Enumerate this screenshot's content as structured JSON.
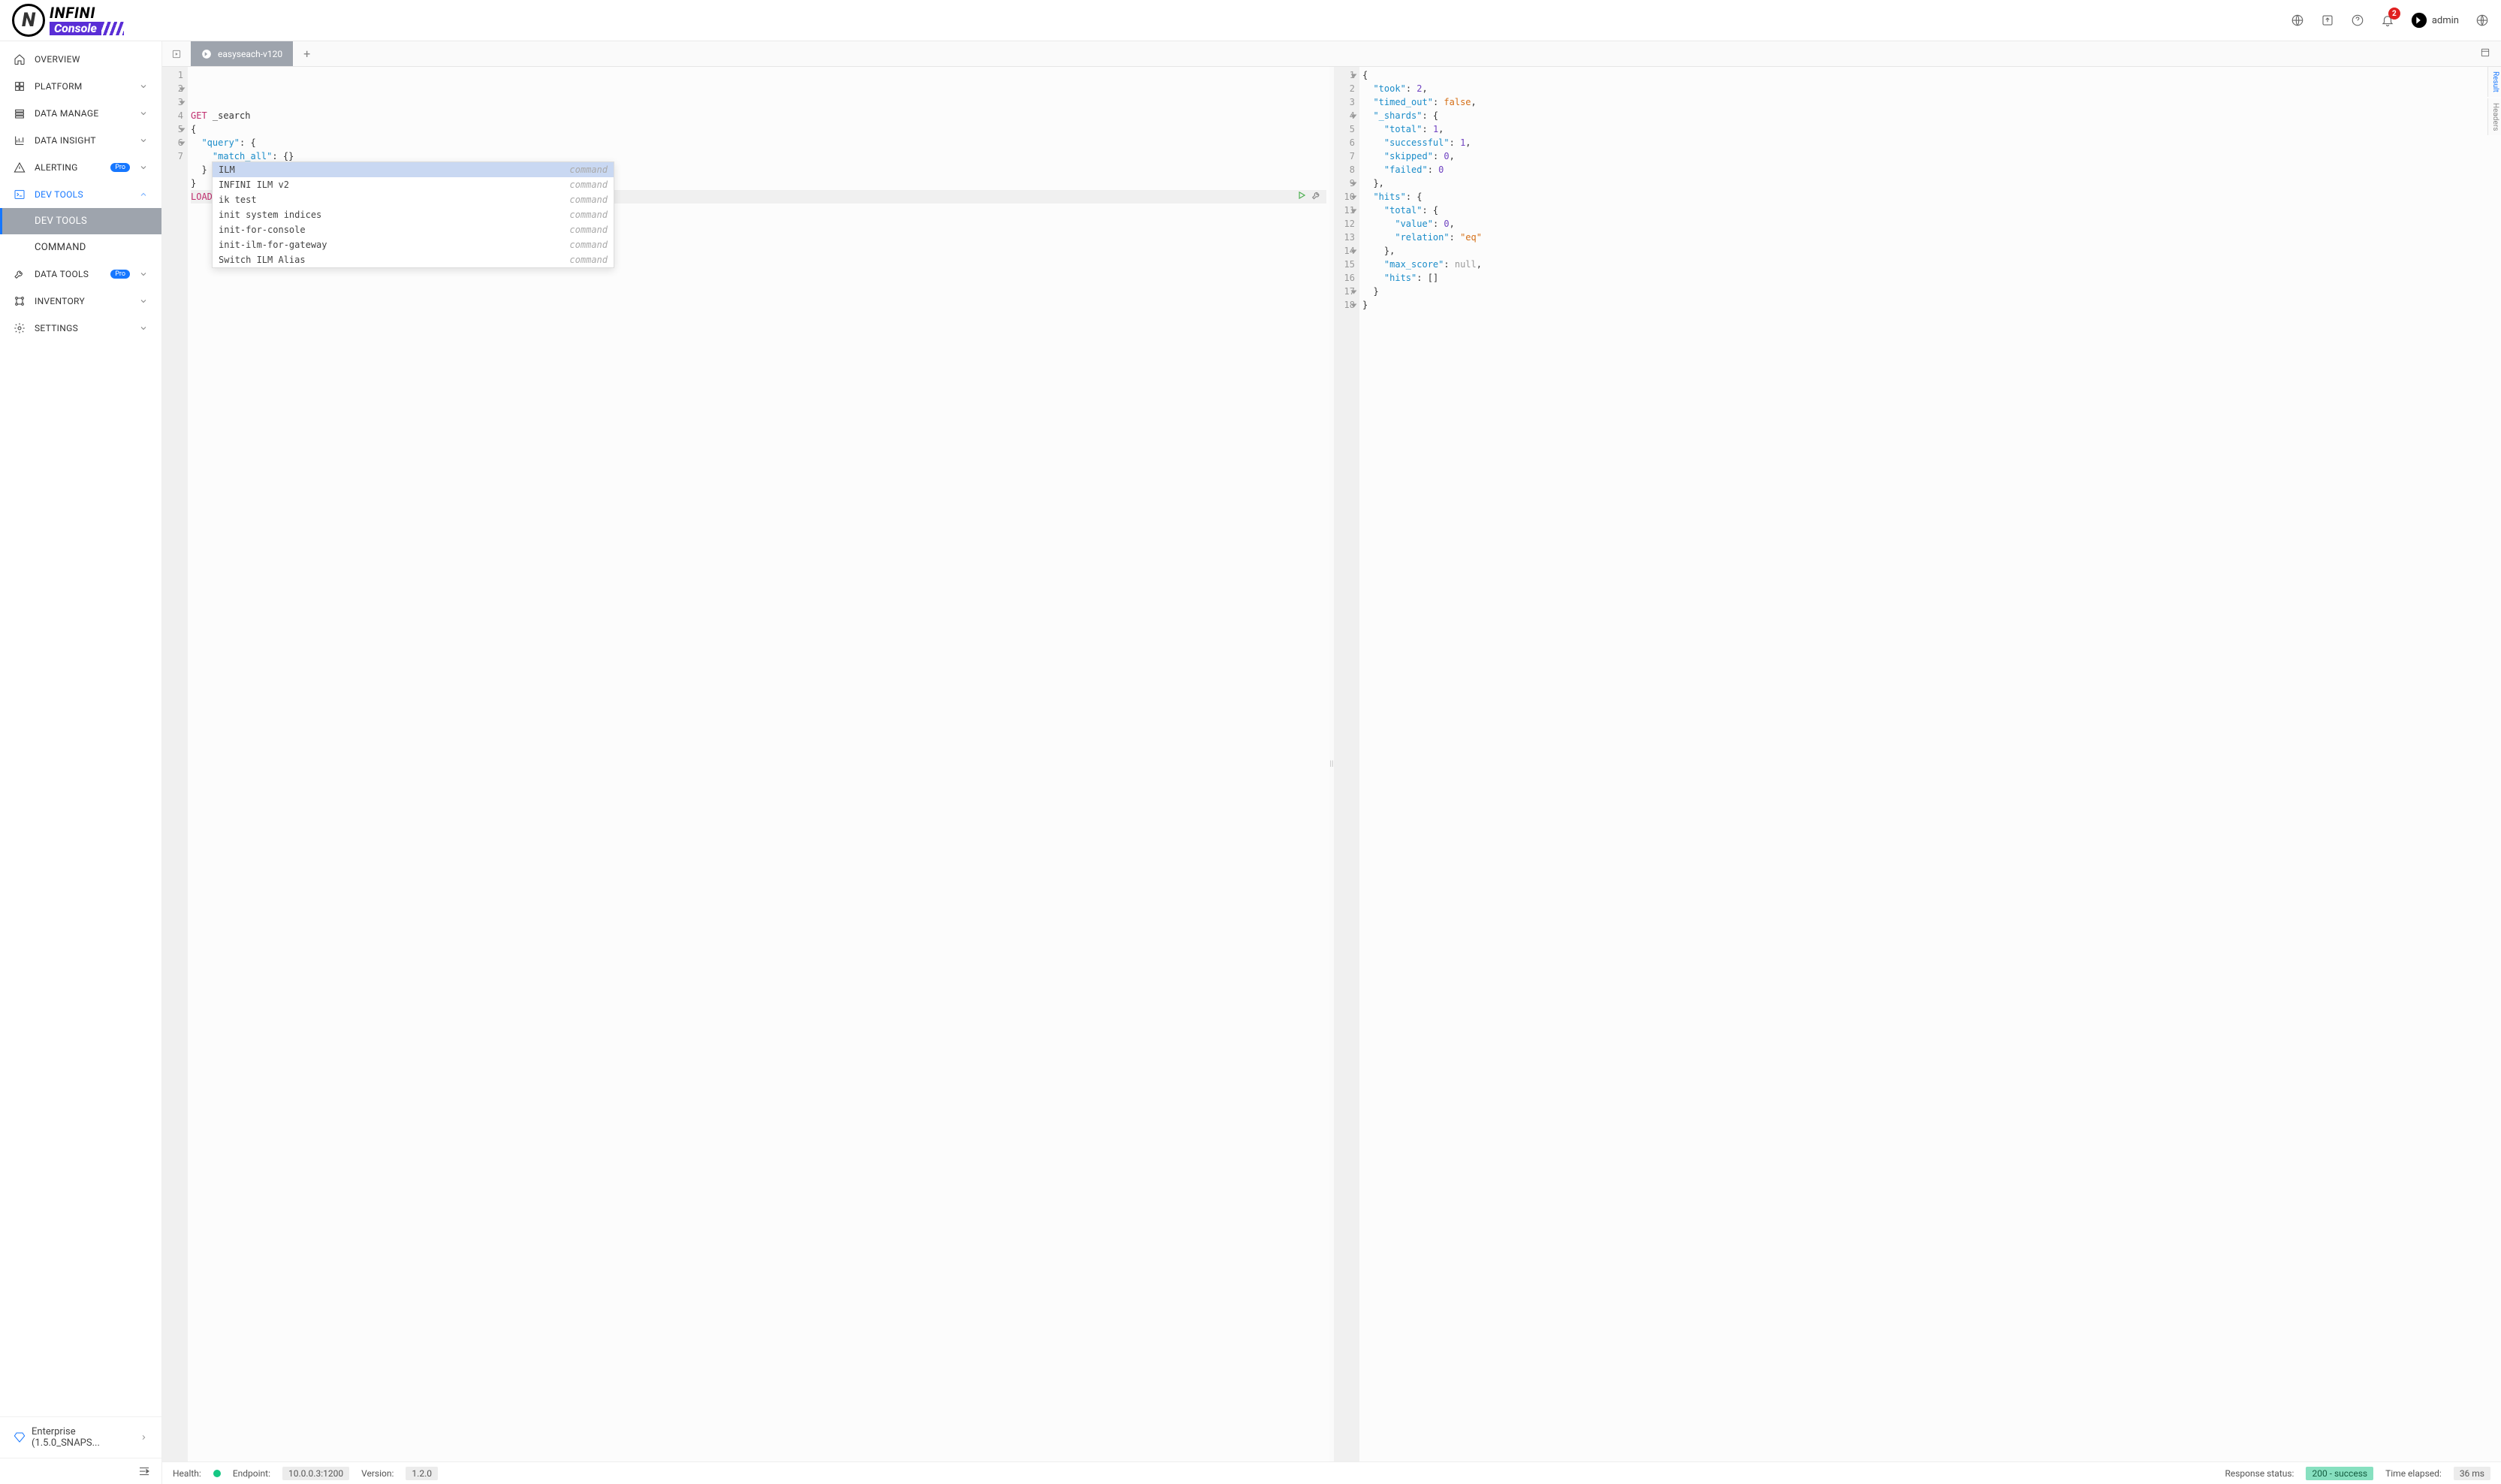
{
  "brand": {
    "name": "INFINI",
    "sub": "Console"
  },
  "header": {
    "notification_count": "2",
    "username": "admin"
  },
  "sidebar": {
    "items": [
      {
        "id": "overview",
        "label": "OVERVIEW",
        "expandable": false
      },
      {
        "id": "platform",
        "label": "PLATFORM",
        "expandable": true
      },
      {
        "id": "data-manage",
        "label": "DATA MANAGE",
        "expandable": true
      },
      {
        "id": "data-insight",
        "label": "DATA INSIGHT",
        "expandable": true
      },
      {
        "id": "alerting",
        "label": "ALERTING",
        "expandable": true,
        "pro": true
      },
      {
        "id": "dev-tools",
        "label": "DEV TOOLS",
        "expandable": true,
        "expanded": true,
        "children": [
          {
            "id": "dev-tools-sub",
            "label": "DEV TOOLS",
            "selected": true
          },
          {
            "id": "command",
            "label": "COMMAND"
          }
        ]
      },
      {
        "id": "data-tools",
        "label": "DATA TOOLS",
        "expandable": true,
        "pro": true
      },
      {
        "id": "inventory",
        "label": "INVENTORY",
        "expandable": true
      },
      {
        "id": "settings",
        "label": "SETTINGS",
        "expandable": true
      }
    ],
    "license": "Enterprise (1.5.0_SNAPS..."
  },
  "tabs": {
    "active": "easyseach-v120"
  },
  "editor": {
    "request_lines": [
      {
        "n": 1,
        "html": "<span class='kw-get'>GET</span> _search"
      },
      {
        "n": 2,
        "html": "{",
        "fold": true
      },
      {
        "n": 3,
        "html": "  <span class='key'>\"query\"</span>: {",
        "fold": true
      },
      {
        "n": 4,
        "html": "    <span class='key'>\"match_all\"</span>: {}"
      },
      {
        "n": 5,
        "html": "  }",
        "fold": true
      },
      {
        "n": 6,
        "html": "}",
        "fold": true
      },
      {
        "n": 7,
        "html": "<span class='kw-load'>LOAD</span> i",
        "current": true
      }
    ],
    "autocomplete": [
      {
        "label": "ILM",
        "kind": "command",
        "selected": true
      },
      {
        "label": "INFINI ILM v2",
        "kind": "command"
      },
      {
        "label": "ik test",
        "kind": "command"
      },
      {
        "label": "init system indices",
        "kind": "command"
      },
      {
        "label": "init-for-console",
        "kind": "command"
      },
      {
        "label": "init-ilm-for-gateway",
        "kind": "command"
      },
      {
        "label": "Switch ILM Alias",
        "kind": "command"
      }
    ],
    "response_lines": [
      {
        "n": 1,
        "html": "{",
        "fold": true
      },
      {
        "n": 2,
        "html": "  <span class='key'>\"took\"</span>: <span class='num'>2</span>,"
      },
      {
        "n": 3,
        "html": "  <span class='key'>\"timed_out\"</span>: <span class='bool'>false</span>,"
      },
      {
        "n": 4,
        "html": "  <span class='key'>\"_shards\"</span>: {",
        "fold": true
      },
      {
        "n": 5,
        "html": "    <span class='key'>\"total\"</span>: <span class='num'>1</span>,"
      },
      {
        "n": 6,
        "html": "    <span class='key'>\"successful\"</span>: <span class='num'>1</span>,"
      },
      {
        "n": 7,
        "html": "    <span class='key'>\"skipped\"</span>: <span class='num'>0</span>,"
      },
      {
        "n": 8,
        "html": "    <span class='key'>\"failed\"</span>: <span class='num'>0</span>"
      },
      {
        "n": 9,
        "html": "  },",
        "fold": true
      },
      {
        "n": 10,
        "html": "  <span class='key'>\"hits\"</span>: {",
        "fold": true
      },
      {
        "n": 11,
        "html": "    <span class='key'>\"total\"</span>: {",
        "fold": true
      },
      {
        "n": 12,
        "html": "      <span class='key'>\"value\"</span>: <span class='num'>0</span>,"
      },
      {
        "n": 13,
        "html": "      <span class='key'>\"relation\"</span>: <span class='str'>\"eq\"</span>"
      },
      {
        "n": 14,
        "html": "    },",
        "fold": true
      },
      {
        "n": 15,
        "html": "    <span class='key'>\"max_score\"</span>: <span class='null'>null</span>,"
      },
      {
        "n": 16,
        "html": "    <span class='key'>\"hits\"</span>: []"
      },
      {
        "n": 17,
        "html": "  }",
        "fold": true
      },
      {
        "n": 18,
        "html": "}",
        "fold": true
      }
    ],
    "side_tabs": {
      "result": "Result",
      "headers": "Headers"
    }
  },
  "statusbar": {
    "health_label": "Health:",
    "endpoint_label": "Endpoint:",
    "endpoint_value": "10.0.0.3:1200",
    "version_label": "Version:",
    "version_value": "1.2.0",
    "resp_status_label": "Response status:",
    "resp_status_value": "200 - success",
    "time_label": "Time elapsed:",
    "time_value": "36 ms"
  }
}
